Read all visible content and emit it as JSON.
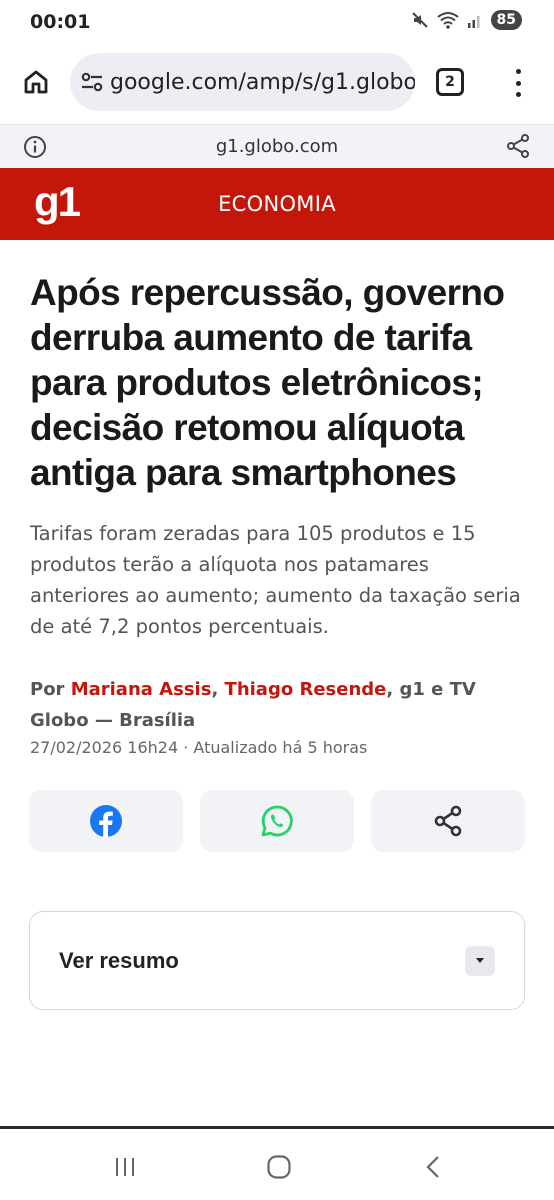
{
  "status_bar": {
    "time": "00:01",
    "battery": "85"
  },
  "browser": {
    "url": "google.com/amp/s/g1.globo.",
    "tab_count": "2"
  },
  "amp_bar": {
    "domain": "g1.globo.com"
  },
  "site_header": {
    "logo": "g1",
    "section": "ECONOMIA"
  },
  "article": {
    "headline": "Após repercussão, governo derruba aumento de tarifa para produtos eletrônicos; decisão retomou alíquota antiga para smartphones",
    "subheadline": "Tarifas foram zeradas para 105 produtos e 15 produtos terão a alíquota nos patamares anteriores ao aumento; aumento da taxação seria de até 7,2 pontos percentuais.",
    "byline_prefix": "Por ",
    "author_1": "Mariana Assis",
    "separator_1": ", ",
    "author_2": "Thiago Resende",
    "byline_suffix": ", g1 e TV Globo — Brasília",
    "date": "27/02/2026 16h24 · Atualizado há 5 horas"
  },
  "share": {
    "icons": [
      "facebook-icon",
      "whatsapp-icon",
      "share-icon"
    ],
    "colors": {
      "facebook": "#1877f2",
      "whatsapp": "#25d366"
    }
  },
  "summary": {
    "label": "Ver resumo"
  },
  "colors": {
    "brand_red": "#c4170c"
  }
}
